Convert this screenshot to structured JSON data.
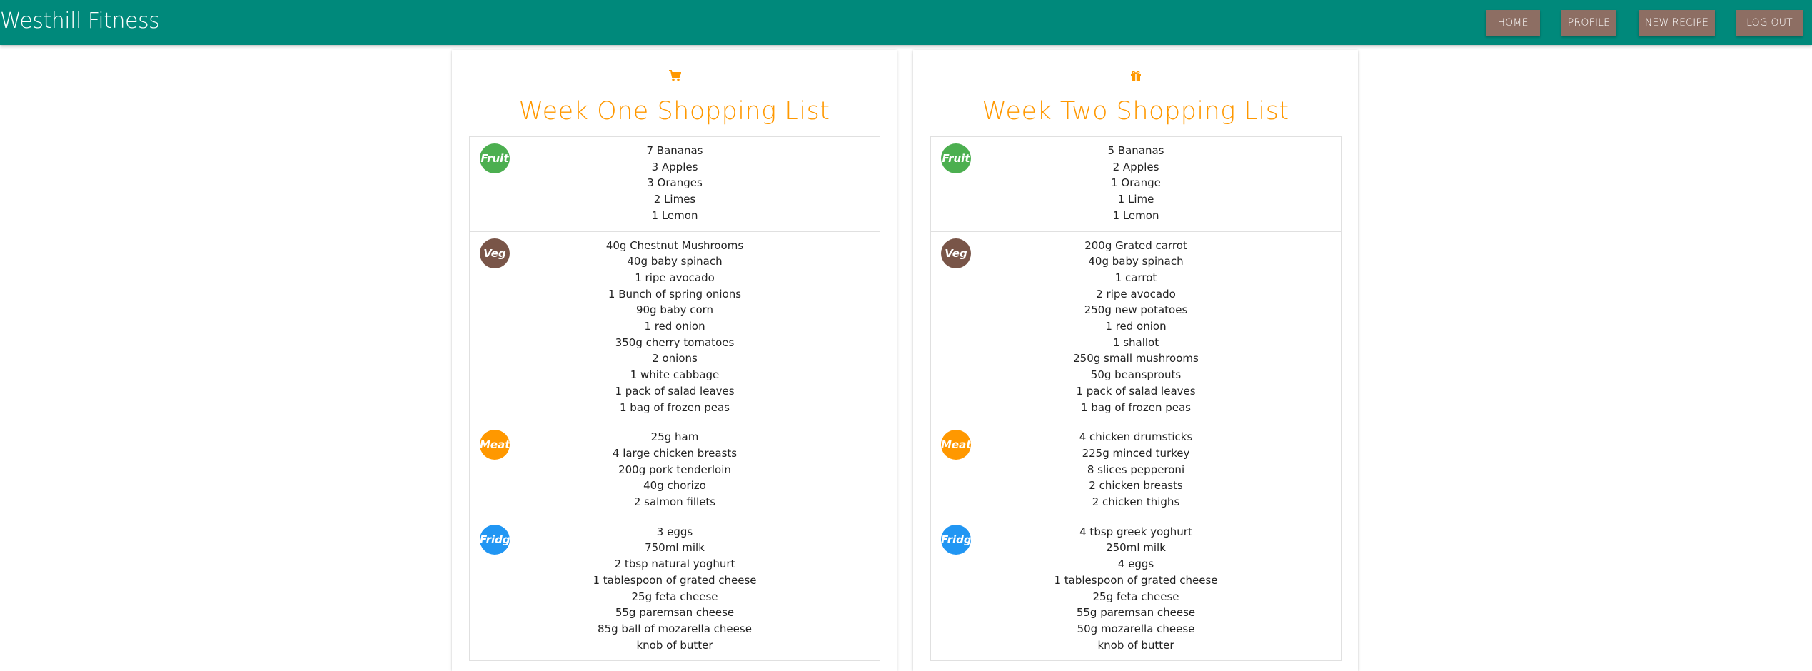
{
  "app": {
    "brand": "Westhill Fitness"
  },
  "nav": [
    {
      "label": "HOME"
    },
    {
      "label": "PROFILE"
    },
    {
      "label": "NEW RECIPE"
    },
    {
      "label": "LOG OUT"
    }
  ],
  "colors": {
    "navbar": "#00897b",
    "nav_button": "#8d6e63",
    "accent": "#ff9800",
    "fruit": "#4caf50",
    "veg": "#795548",
    "meat": "#ff9800",
    "fridge": "#2196f3"
  },
  "lists": [
    {
      "icon": "shopping-cart-icon",
      "title": "Week One Shopping List",
      "sections": [
        {
          "badge": "Fruit",
          "items": [
            "7 Bananas",
            "3 Apples",
            "3 Oranges",
            "2 Limes",
            "1 Lemon"
          ]
        },
        {
          "badge": "Veg",
          "items": [
            "40g Chestnut Mushrooms",
            "40g baby spinach",
            "1 ripe avocado",
            "1 Bunch of spring onions",
            "90g baby corn",
            "1 red onion",
            "350g cherry tomatoes",
            "2 onions",
            "1 white cabbage",
            "1 pack of salad leaves",
            "1 bag of frozen peas"
          ]
        },
        {
          "badge": "Meat",
          "items": [
            "25g ham",
            "4 large chicken breasts",
            "200g pork tenderloin",
            "40g chorizo",
            "2 salmon fillets"
          ]
        },
        {
          "badge": "Fridge",
          "items": [
            "3 eggs",
            "750ml milk",
            "2 tbsp natural yoghurt",
            "1 tablespoon of grated cheese",
            "25g feta cheese",
            "55g paremsan cheese",
            "85g ball of mozarella cheese",
            "knob of butter"
          ]
        }
      ]
    },
    {
      "icon": "gift-icon",
      "title": "Week Two Shopping List",
      "sections": [
        {
          "badge": "Fruit",
          "items": [
            "5 Bananas",
            "2 Apples",
            "1 Orange",
            "1 Lime",
            "1 Lemon"
          ]
        },
        {
          "badge": "Veg",
          "items": [
            "200g Grated carrot",
            "40g baby spinach",
            "1 carrot",
            "2 ripe avocado",
            "250g new potatoes",
            "1 red onion",
            "1 shallot",
            "250g small mushrooms",
            "50g beansprouts",
            "1 pack of salad leaves",
            "1 bag of frozen peas"
          ]
        },
        {
          "badge": "Meat",
          "items": [
            "4 chicken drumsticks",
            "225g minced turkey",
            "8 slices pepperoni",
            "2 chicken breasts",
            "2 chicken thighs"
          ]
        },
        {
          "badge": "Fridge",
          "items": [
            "4 tbsp greek yoghurt",
            "250ml milk",
            "4 eggs",
            "1 tablespoon of grated cheese",
            "25g feta cheese",
            "55g paremsan cheese",
            "50g mozarella cheese",
            "knob of butter"
          ]
        }
      ]
    }
  ]
}
